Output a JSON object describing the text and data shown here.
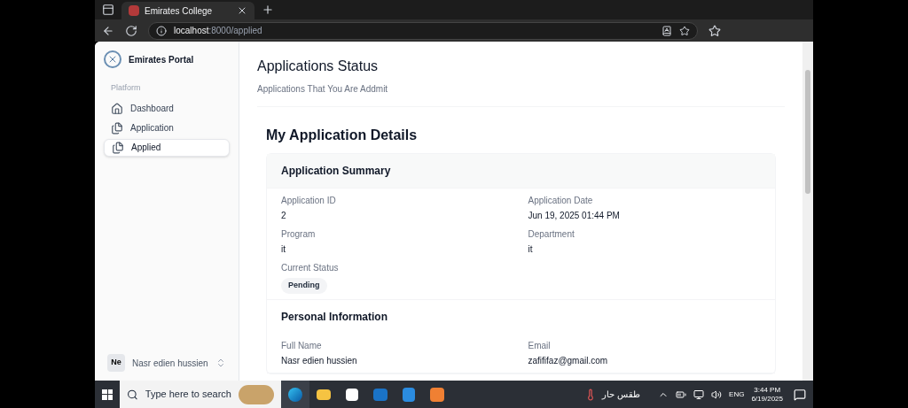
{
  "browser": {
    "tab_title": "Emirates College",
    "url_host": "localhost",
    "url_path": ":8000/applied"
  },
  "sidebar": {
    "brand": "Emirates Portal",
    "section_label": "Platform",
    "items": [
      {
        "label": "Dashboard",
        "selected": false
      },
      {
        "label": "Application",
        "selected": false
      },
      {
        "label": "Applied",
        "selected": true
      }
    ],
    "user": {
      "initials": "Ne",
      "name": "Nasr edien hussien"
    }
  },
  "main": {
    "title": "Applications Status",
    "subtitle": "Applications That You Are Addmit",
    "details_heading": "My Application Details",
    "sections": [
      {
        "title": "Application Summary",
        "fields": [
          {
            "label": "Application ID",
            "value": "2",
            "kind": "text"
          },
          {
            "label": "Application Date",
            "value": "Jun 19, 2025 01:44 PM",
            "kind": "text"
          },
          {
            "label": "Program",
            "value": "it",
            "kind": "text"
          },
          {
            "label": "Department",
            "value": "it",
            "kind": "text"
          },
          {
            "label": "Current Status",
            "value": "Pending",
            "kind": "badge"
          }
        ]
      },
      {
        "title": "Personal Information",
        "fields": [
          {
            "label": "Full Name",
            "value": "Nasr edien hussien",
            "kind": "text"
          },
          {
            "label": "Email",
            "value": "zafififaz@gmail.com",
            "kind": "text"
          }
        ]
      }
    ]
  },
  "taskbar": {
    "search_placeholder": "Type here to search",
    "weather": "طقس حار",
    "language": "ENG",
    "time": "3:44 PM",
    "date": "6/19/2025"
  }
}
